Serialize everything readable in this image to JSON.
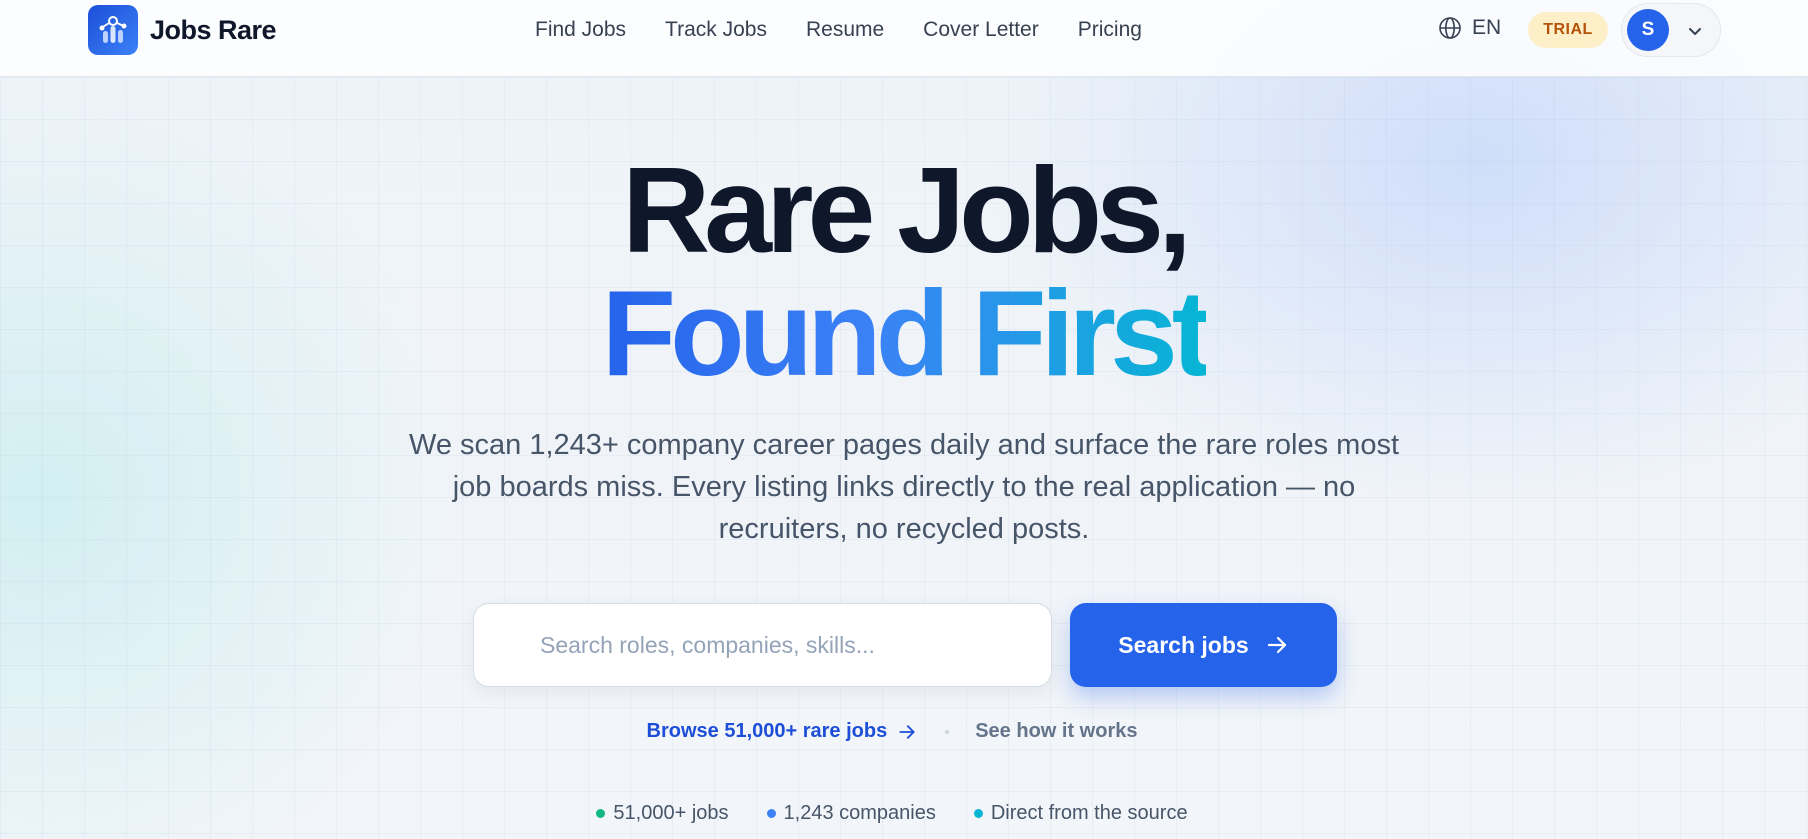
{
  "brand": {
    "name": "Jobs Rare"
  },
  "nav": {
    "items": [
      {
        "label": "Find Jobs"
      },
      {
        "label": "Track Jobs"
      },
      {
        "label": "Resume"
      },
      {
        "label": "Cover Letter"
      },
      {
        "label": "Pricing"
      }
    ]
  },
  "header": {
    "language": "EN",
    "trial_badge": "TRIAL",
    "avatar_initial": "S"
  },
  "hero": {
    "title_line1": "Rare Jobs,",
    "title_line2": "Found First",
    "subtitle": "We scan 1,243+ company career pages daily and surface the rare roles most job boards miss. Every listing links directly to the real application — no recruiters, no recycled posts."
  },
  "search": {
    "placeholder": "Search roles, companies, skills...",
    "value": "",
    "button_label": "Search jobs"
  },
  "links": {
    "browse_label": "Browse 51,000+ rare jobs",
    "how_label": "See how it works"
  },
  "stats": [
    {
      "label": "51,000+ jobs",
      "color": "#10b981"
    },
    {
      "label": "1,243 companies",
      "color": "#3b82f6"
    },
    {
      "label": "Direct from the source",
      "color": "#06b6d4"
    }
  ],
  "colors": {
    "accent": "#2563eb",
    "heading": "#0f172a",
    "trial_bg": "#fdefc7",
    "trial_text": "#b45309"
  }
}
